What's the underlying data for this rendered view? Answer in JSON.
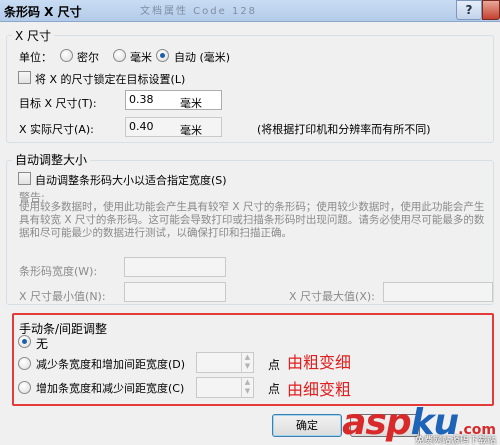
{
  "window": {
    "title": "条形码 X 尺寸",
    "background_tabs": "  文档属性     Code 128",
    "help_label": "?"
  },
  "x_size": {
    "group_title": "X 尺寸",
    "unit_label": "单位：",
    "unit_options": [
      "密尔",
      "毫米",
      "自动 (毫米)"
    ],
    "unit_selected": "自动 (毫米)",
    "lock_label": "将 X 的尺寸锁定在目标设置(L)",
    "lock_checked": false,
    "target_label": "目标 X 尺寸(T):",
    "target_value": "0.38",
    "target_unit": "毫米",
    "actual_label": "X 实际尺寸(A):",
    "actual_value": "0.40",
    "actual_unit": "毫米",
    "actual_note": "(将根据打印机和分辨率而有所不同)"
  },
  "auto_adjust": {
    "group_title": "自动调整大小",
    "fit_label": "自动调整条形码大小以适合指定宽度(S)",
    "fit_checked": false,
    "warning_title": "警告:",
    "warning_text": "使用较多数据时，使用此功能会产生具有较窄 X 尺寸的条形码；使用较少数据时，使用此功能会产生具有较宽 X 尺寸的条形码。这可能会导致打印或扫描条形码时出现问题。请务必使用尽可能最多的数据和尽可能最少的数据进行测试，以确保打印和扫描正确。",
    "width_label": "条形码宽度(W):",
    "min_label": "X 尺寸最小值(N):",
    "max_label": "X 尺寸最大值(X):"
  },
  "manual": {
    "group_title": "手动条/间距调整",
    "options": [
      "无",
      "减少条宽度和增加间距宽度(D)",
      "增加条宽度和减少间距宽度(C)"
    ],
    "selected": "无",
    "unit": "点"
  },
  "annotations": {
    "note_thin_to_bold": "由粗变细",
    "note_bold_to_thin": "由细变粗"
  },
  "buttons": {
    "ok": "确定"
  },
  "watermark": {
    "brand_red": "asp",
    "brand_blue": "ku",
    "brand_tail": ".com",
    "tagline": "免费网站源码下载站"
  },
  "colors": {
    "highlight_border": "#e33a3a",
    "annotation_text": "#e02020",
    "radio_dot": "#1c5ea8"
  }
}
